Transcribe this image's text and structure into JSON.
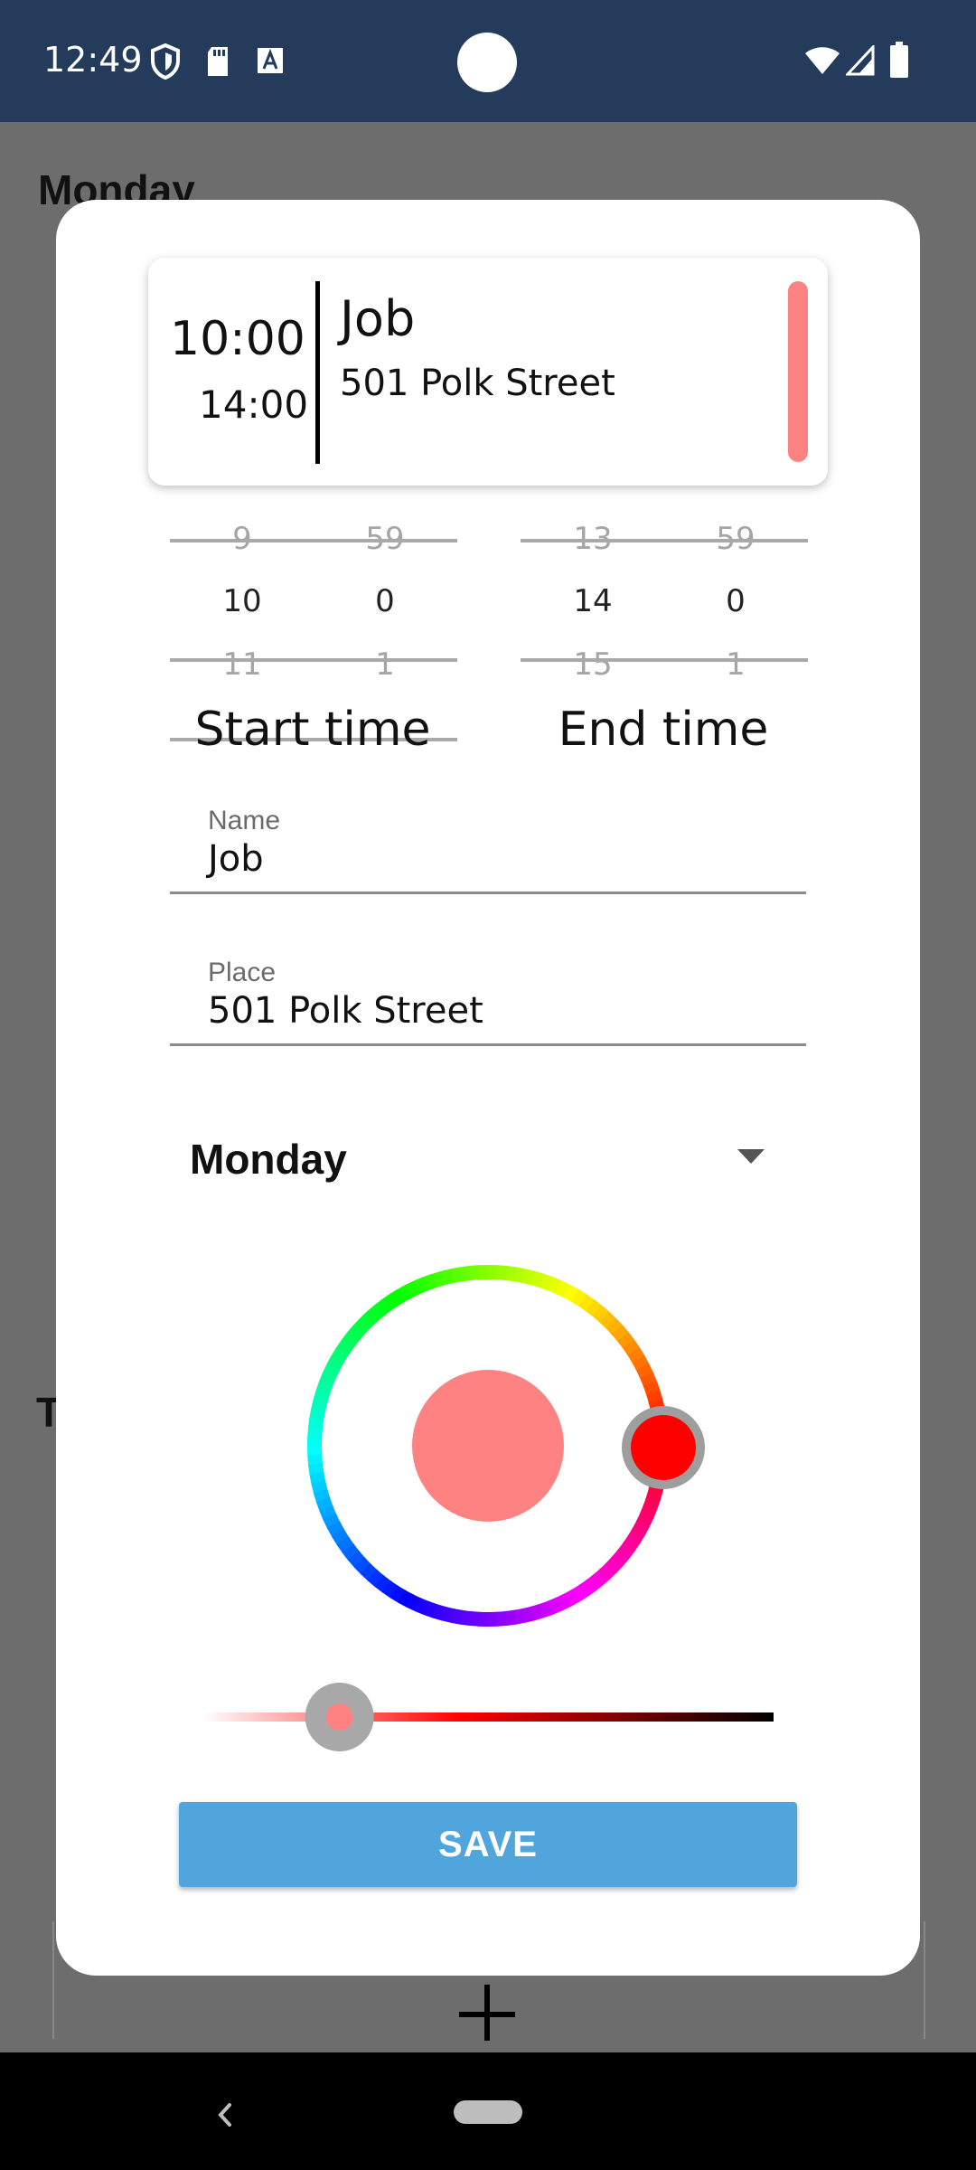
{
  "status_bar": {
    "time": "12:49",
    "icons": [
      "shield-icon",
      "sd-card-icon",
      "a-icon",
      "wifi-icon",
      "signal-icon",
      "battery-icon"
    ]
  },
  "background_app": {
    "heading": "Monday",
    "partial_letter": "T"
  },
  "preview": {
    "start": "10:00",
    "end": "14:00",
    "name": "Job",
    "place": "501 Polk Street",
    "color": "#fe8282"
  },
  "start_picker": {
    "label": "Start time",
    "hour": {
      "prev": "9",
      "current": "10",
      "next": "11"
    },
    "minute": {
      "prev": "59",
      "current": "0",
      "next": "1"
    }
  },
  "end_picker": {
    "label": "End time",
    "hour": {
      "prev": "13",
      "current": "14",
      "next": "15"
    },
    "minute": {
      "prev": "59",
      "current": "0",
      "next": "1"
    }
  },
  "name_field": {
    "label": "Name",
    "value": "Job"
  },
  "place_field": {
    "label": "Place",
    "value": "501 Polk Street"
  },
  "day_select": {
    "value": "Monday"
  },
  "color_picker": {
    "selected_color": "#fe8282",
    "hue_color": "#ff0000",
    "lightness_slider_fraction": 0.24
  },
  "save_button": {
    "label": "SAVE"
  },
  "colors": {
    "status_bar": "#243b5b",
    "accent_button": "#4fa5dc"
  }
}
